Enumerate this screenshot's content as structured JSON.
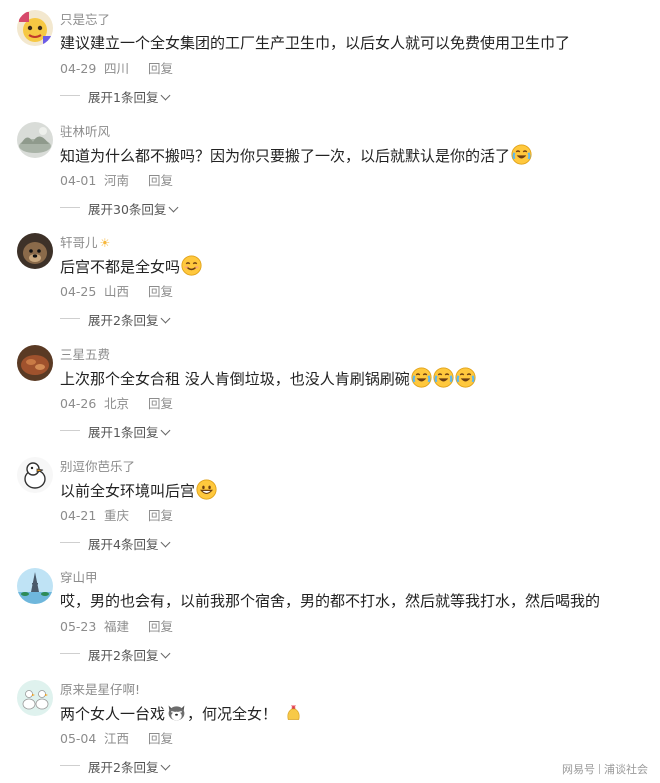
{
  "comments": [
    {
      "username": "只是忘了",
      "text": "建议建立一个全女集团的工厂生产卫生巾，以后女人就可以免费使用卫生巾了",
      "emojis": [],
      "date": "04-29",
      "location": "四川",
      "reply_label": "回复",
      "expand_label": "展开1条回复"
    },
    {
      "username": "驻林听风",
      "text": "知道为什么都不搬吗？因为你只要搬了一次，以后就默认是你的活了",
      "emojis": [
        "crying-laughing-emoji"
      ],
      "date": "04-01",
      "location": "河南",
      "reply_label": "回复",
      "expand_label": "展开30条回复"
    },
    {
      "username": "轩哥儿",
      "username_emoji": "☀",
      "text": "后宫不都是全女吗",
      "emojis": [
        "smiling-emoji"
      ],
      "date": "04-25",
      "location": "山西",
      "reply_label": "回复",
      "expand_label": "展开2条回复"
    },
    {
      "username": "三星五费",
      "text": "上次那个全女合租 没人肯倒垃圾，也没人肯刷锅刷碗",
      "emojis": [
        "crying-laughing-emoji",
        "crying-laughing-emoji",
        "crying-laughing-emoji"
      ],
      "date": "04-26",
      "location": "北京",
      "reply_label": "回复",
      "expand_label": "展开1条回复"
    },
    {
      "username": "别逗你芭乐了",
      "text": "以前全女环境叫后宫",
      "emojis": [
        "grinning-emoji"
      ],
      "date": "04-21",
      "location": "重庆",
      "reply_label": "回复",
      "expand_label": "展开4条回复"
    },
    {
      "username": "穿山甲",
      "text": "哎，男的也会有，以前我那个宿舍，男的都不打水，然后就等我打水，然后喝我的",
      "emojis": [],
      "date": "05-23",
      "location": "福建",
      "reply_label": "回复",
      "expand_label": "展开2条回复"
    },
    {
      "username": "原来是星仔啊!",
      "text_before": "两个女人一台戏",
      "text_after": "，何况全女！",
      "emojis": [
        "husky-dog-emoji",
        "lucky-bag-emoji"
      ],
      "date": "05-04",
      "location": "江西",
      "reply_label": "回复",
      "expand_label": "展开2条回复"
    }
  ],
  "watermark": {
    "brand": "网易号",
    "account": "浦谈社会"
  },
  "colors": {
    "meta_text": "#8c8c8c",
    "body_text": "#222222",
    "emoji_yellow": "#ffc83d"
  }
}
